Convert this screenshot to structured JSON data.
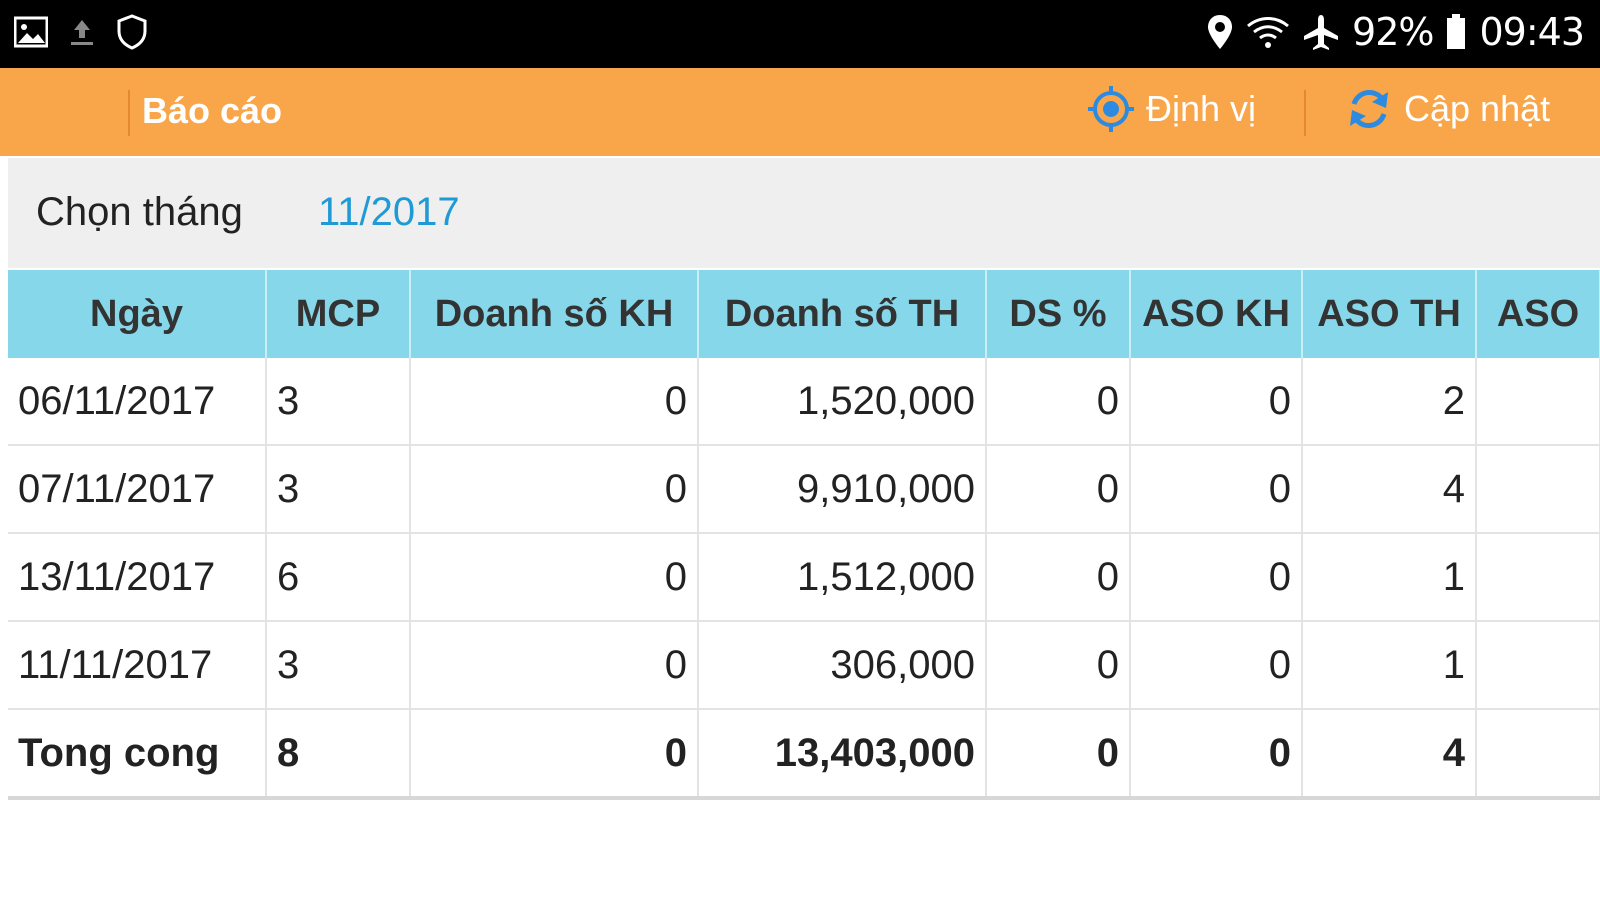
{
  "status_bar": {
    "battery": "92%",
    "time": "09:43",
    "left_icons": [
      "image-icon",
      "upload-icon",
      "shield-icon"
    ],
    "right_icons": [
      "location-icon",
      "wifi-icon",
      "airplane-icon",
      "battery-icon"
    ]
  },
  "toolbar": {
    "title": "Báo cáo",
    "locate_label": "Định vị",
    "refresh_label": "Cập nhật",
    "background_color": "#f9a64b",
    "icon_color": "#2c8be0"
  },
  "filter": {
    "label": "Chọn tháng",
    "value": "11/2017",
    "value_color": "#1f9ad6"
  },
  "table": {
    "header_color": "#86d7e9",
    "columns": [
      "Ngày",
      "MCP",
      "Doanh số KH",
      "Doanh số TH",
      "DS %",
      "ASO KH",
      "ASO TH",
      "ASO"
    ],
    "rows": [
      [
        "06/11/2017",
        "3",
        "0",
        "1,520,000",
        "0",
        "0",
        "2",
        ""
      ],
      [
        "07/11/2017",
        "3",
        "0",
        "9,910,000",
        "0",
        "0",
        "4",
        ""
      ],
      [
        "13/11/2017",
        "6",
        "0",
        "1,512,000",
        "0",
        "0",
        "1",
        ""
      ],
      [
        "11/11/2017",
        "3",
        "0",
        "306,000",
        "0",
        "0",
        "1",
        ""
      ]
    ],
    "total": [
      "Tong cong",
      "8",
      "0",
      "13,403,000",
      "0",
      "0",
      "4",
      ""
    ]
  }
}
